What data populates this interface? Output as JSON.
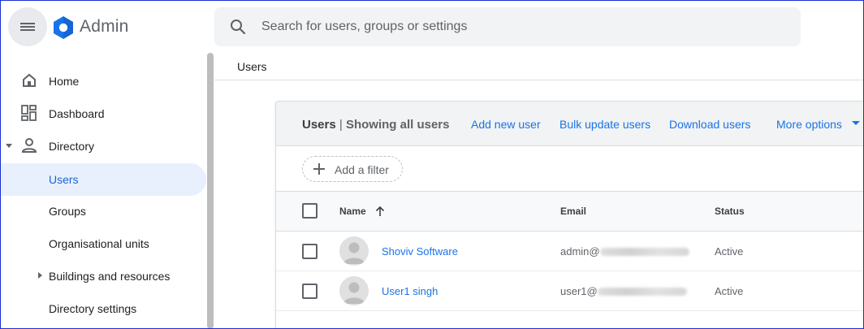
{
  "app": {
    "title": "Admin",
    "accent": "#1a73e8",
    "logo_color": "#1a73e8"
  },
  "search": {
    "placeholder": "Search for users, groups or settings"
  },
  "sidebar": {
    "items": [
      {
        "label": "Home",
        "icon": "home-icon"
      },
      {
        "label": "Dashboard",
        "icon": "dashboard-icon"
      },
      {
        "label": "Directory",
        "icon": "person-icon",
        "expanded": true
      },
      {
        "label": "Users",
        "active": true
      },
      {
        "label": "Groups"
      },
      {
        "label": "Organisational units"
      },
      {
        "label": "Buildings and resources",
        "collapsed": true
      },
      {
        "label": "Directory settings"
      }
    ]
  },
  "breadcrumb": {
    "current": "Users"
  },
  "card": {
    "title": "Users",
    "separator": "|",
    "subtitle": "Showing all users",
    "actions": [
      "Add new user",
      "Bulk update users",
      "Download users",
      "More options"
    ],
    "filter_label": "Add a filter",
    "columns": [
      "Name",
      "Email",
      "Status"
    ],
    "rows": [
      {
        "name": "Shoviv Software",
        "email_prefix": "admin@",
        "status": "Active"
      },
      {
        "name": "User1 singh",
        "email_prefix": "user1@",
        "status": "Active"
      }
    ]
  }
}
